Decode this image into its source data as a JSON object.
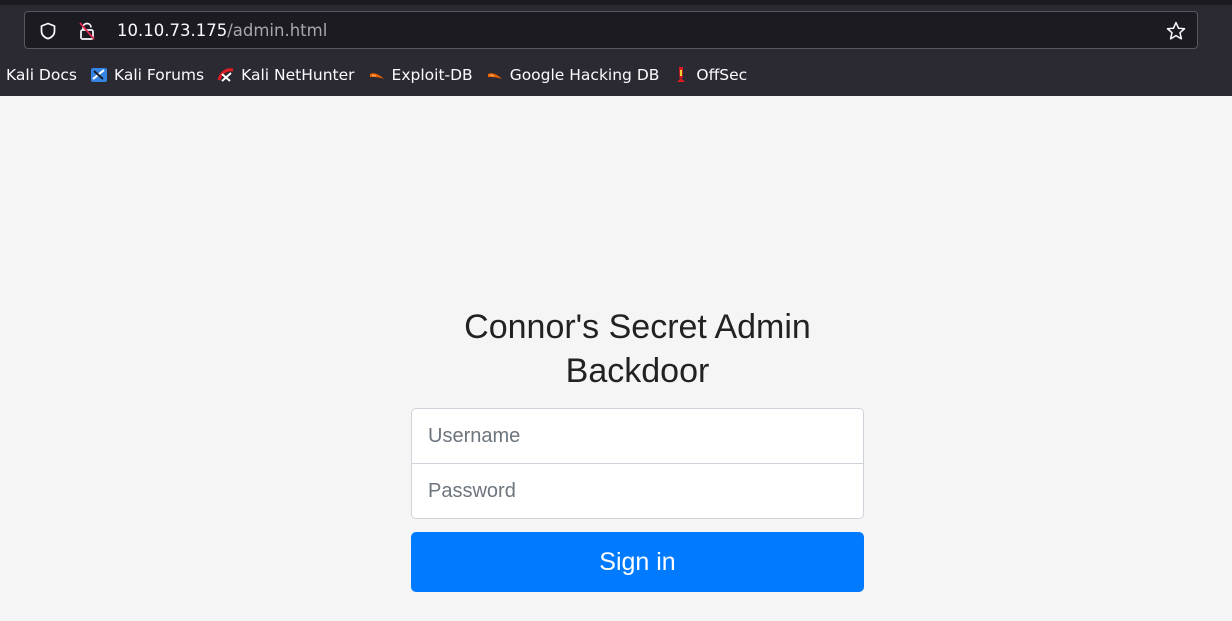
{
  "browser": {
    "url_host": "10.10.73.175",
    "url_path": "/admin.html",
    "bookmarks": [
      {
        "label": "Kali Docs",
        "icon": "none"
      },
      {
        "label": "Kali Forums",
        "icon": "kali-forums-icon"
      },
      {
        "label": "Kali NetHunter",
        "icon": "kali-nethunter-icon"
      },
      {
        "label": "Exploit-DB",
        "icon": "exploit-db-icon"
      },
      {
        "label": "Google Hacking DB",
        "icon": "exploit-db-icon"
      },
      {
        "label": "OffSec",
        "icon": "offsec-icon"
      }
    ]
  },
  "page": {
    "heading_line1": "Connor's Secret Admin",
    "heading_line2": "Backdoor",
    "username_placeholder": "Username",
    "password_placeholder": "Password",
    "signin_label": "Sign in"
  },
  "colors": {
    "primary": "#007bff",
    "chrome_bg": "#2b2a33",
    "page_bg": "#f5f5f5"
  }
}
